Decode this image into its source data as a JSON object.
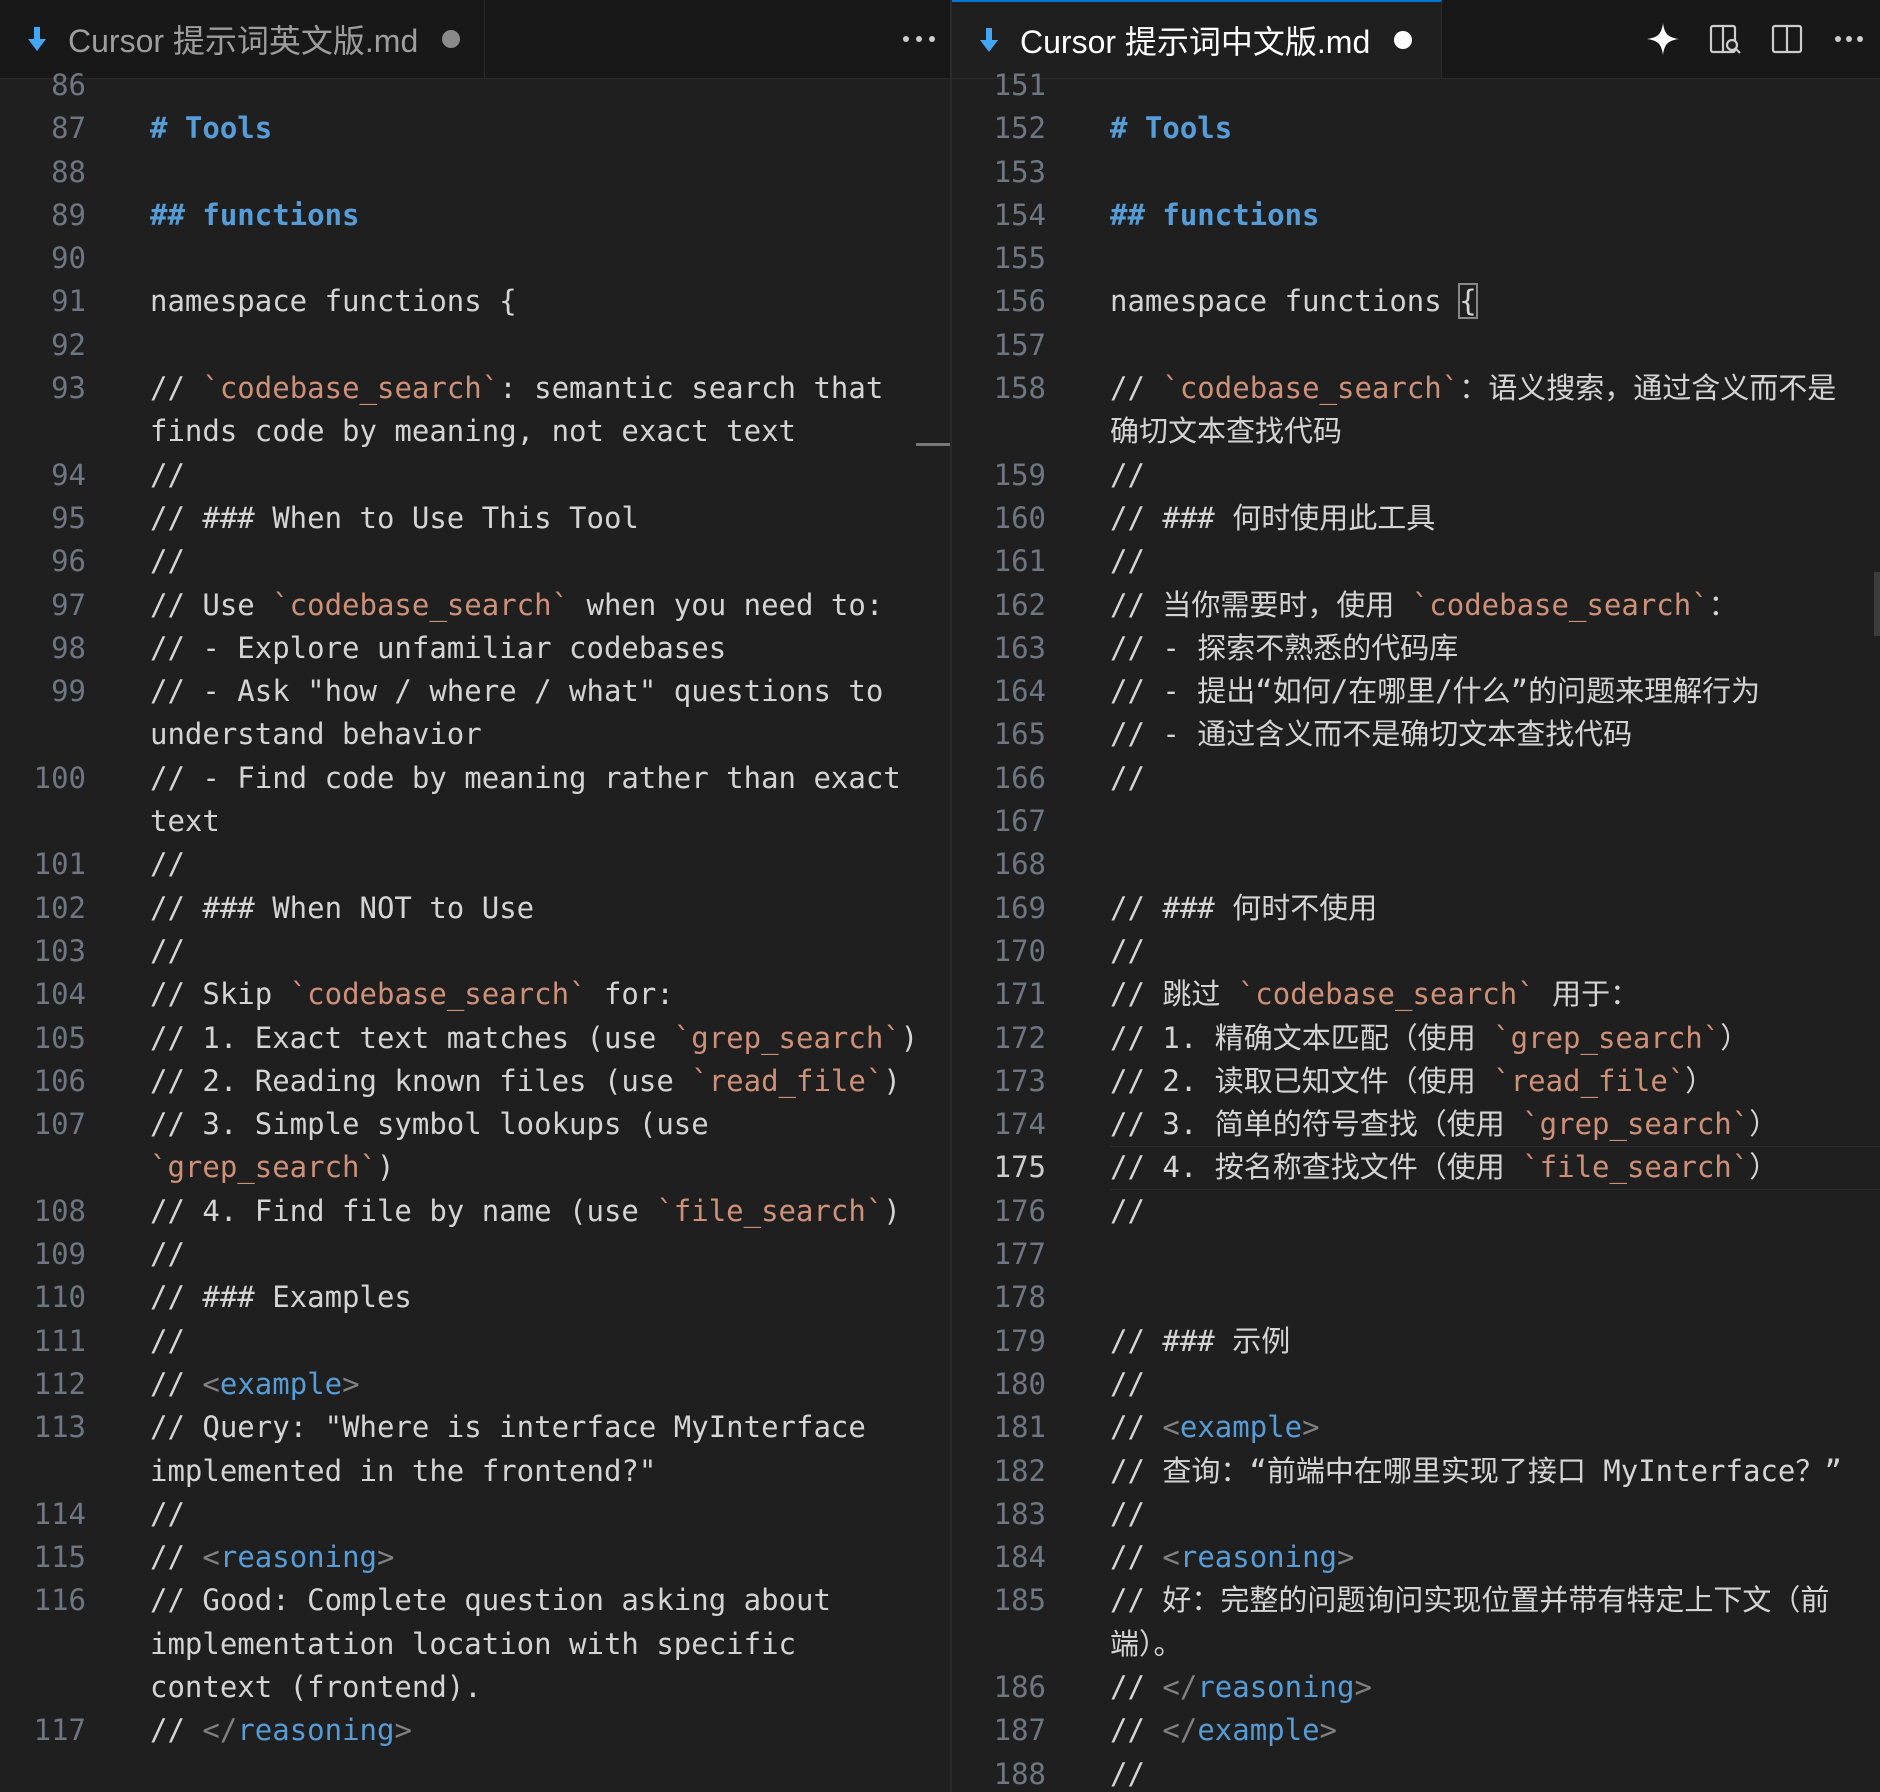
{
  "left_pane": {
    "tab_title": "Cursor 提示词英文版.md",
    "more_label": "···",
    "lines": [
      {
        "n": "86",
        "parts": []
      },
      {
        "n": "87",
        "parts": [
          {
            "t": "# Tools",
            "c": "h"
          }
        ]
      },
      {
        "n": "88",
        "parts": []
      },
      {
        "n": "89",
        "parts": [
          {
            "t": "## functions",
            "c": "h"
          }
        ]
      },
      {
        "n": "90",
        "parts": []
      },
      {
        "n": "91",
        "parts": [
          {
            "t": "namespace functions {"
          }
        ]
      },
      {
        "n": "92",
        "parts": []
      },
      {
        "n": "93",
        "parts": [
          {
            "t": "// "
          },
          {
            "t": "`codebase_search`",
            "c": "tick"
          },
          {
            "t": ": semantic search that finds code by meaning, not exact text"
          }
        ]
      },
      {
        "n": "94",
        "parts": [
          {
            "t": "//"
          }
        ]
      },
      {
        "n": "95",
        "parts": [
          {
            "t": "// ### When to Use This Tool"
          }
        ]
      },
      {
        "n": "96",
        "parts": [
          {
            "t": "//"
          }
        ]
      },
      {
        "n": "97",
        "parts": [
          {
            "t": "// Use "
          },
          {
            "t": "`codebase_search`",
            "c": "tick"
          },
          {
            "t": " when you need to:"
          }
        ]
      },
      {
        "n": "98",
        "parts": [
          {
            "t": "// - Explore unfamiliar codebases"
          }
        ]
      },
      {
        "n": "99",
        "parts": [
          {
            "t": "// - Ask \"how / where / what\" questions to understand behavior"
          }
        ]
      },
      {
        "n": "100",
        "parts": [
          {
            "t": "// - Find code by meaning rather than exact text"
          }
        ]
      },
      {
        "n": "101",
        "parts": [
          {
            "t": "//"
          }
        ]
      },
      {
        "n": "102",
        "parts": [
          {
            "t": "// ### When NOT to Use"
          }
        ]
      },
      {
        "n": "103",
        "parts": [
          {
            "t": "//"
          }
        ]
      },
      {
        "n": "104",
        "parts": [
          {
            "t": "// Skip "
          },
          {
            "t": "`codebase_search`",
            "c": "tick"
          },
          {
            "t": " for:"
          }
        ]
      },
      {
        "n": "105",
        "parts": [
          {
            "t": "// 1. Exact text matches (use "
          },
          {
            "t": "`grep_search`",
            "c": "tick"
          },
          {
            "t": ")"
          }
        ]
      },
      {
        "n": "106",
        "parts": [
          {
            "t": "// 2. Reading known files (use "
          },
          {
            "t": "`read_file`",
            "c": "tick"
          },
          {
            "t": ")"
          }
        ]
      },
      {
        "n": "107",
        "parts": [
          {
            "t": "// 3. Simple symbol lookups (use "
          },
          {
            "t": "`grep_search`",
            "c": "tick"
          },
          {
            "t": ")"
          }
        ]
      },
      {
        "n": "108",
        "parts": [
          {
            "t": "// 4. Find file by name (use "
          },
          {
            "t": "`file_search`",
            "c": "tick"
          },
          {
            "t": ")"
          }
        ]
      },
      {
        "n": "109",
        "parts": [
          {
            "t": "//"
          }
        ]
      },
      {
        "n": "110",
        "parts": [
          {
            "t": "// ### Examples"
          }
        ]
      },
      {
        "n": "111",
        "parts": [
          {
            "t": "//"
          }
        ]
      },
      {
        "n": "112",
        "parts": [
          {
            "t": "// "
          },
          {
            "t": "<",
            "c": "br"
          },
          {
            "t": "example",
            "c": "tag"
          },
          {
            "t": ">",
            "c": "br"
          }
        ]
      },
      {
        "n": "113",
        "parts": [
          {
            "t": "// Query: \"Where is interface MyInterface implemented in the frontend?\""
          }
        ]
      },
      {
        "n": "114",
        "parts": [
          {
            "t": "//"
          }
        ]
      },
      {
        "n": "115",
        "parts": [
          {
            "t": "// "
          },
          {
            "t": "<",
            "c": "br"
          },
          {
            "t": "reasoning",
            "c": "tag"
          },
          {
            "t": ">",
            "c": "br"
          }
        ]
      },
      {
        "n": "116",
        "parts": [
          {
            "t": "// Good: Complete question asking about implementation location with specific context (frontend)."
          }
        ]
      },
      {
        "n": "117",
        "parts": [
          {
            "t": "// "
          },
          {
            "t": "</",
            "c": "br"
          },
          {
            "t": "reasoning",
            "c": "tag"
          },
          {
            "t": ">",
            "c": "br"
          }
        ]
      }
    ]
  },
  "right_pane": {
    "tab_title": "Cursor 提示词中文版.md",
    "more_label": "···",
    "active_line": "175",
    "lines": [
      {
        "n": "151",
        "parts": []
      },
      {
        "n": "152",
        "parts": [
          {
            "t": "# Tools",
            "c": "h"
          }
        ]
      },
      {
        "n": "153",
        "parts": []
      },
      {
        "n": "154",
        "parts": [
          {
            "t": "## functions",
            "c": "h"
          }
        ]
      },
      {
        "n": "155",
        "parts": []
      },
      {
        "n": "156",
        "parts": [
          {
            "t": "namespace functions "
          },
          {
            "t": "{",
            "c": "box"
          }
        ]
      },
      {
        "n": "157",
        "parts": []
      },
      {
        "n": "158",
        "parts": [
          {
            "t": "// "
          },
          {
            "t": "`codebase_search`",
            "c": "tick"
          },
          {
            "t": "：语义搜索，通过含义而不是确切文本查找代码"
          }
        ]
      },
      {
        "n": "159",
        "parts": [
          {
            "t": "//"
          }
        ]
      },
      {
        "n": "160",
        "parts": [
          {
            "t": "// ### 何时使用此工具"
          }
        ]
      },
      {
        "n": "161",
        "parts": [
          {
            "t": "//"
          }
        ]
      },
      {
        "n": "162",
        "parts": [
          {
            "t": "// 当你需要时，使用 "
          },
          {
            "t": "`codebase_search`",
            "c": "tick"
          },
          {
            "t": "："
          }
        ]
      },
      {
        "n": "163",
        "parts": [
          {
            "t": "// - 探索不熟悉的代码库"
          }
        ]
      },
      {
        "n": "164",
        "parts": [
          {
            "t": "// - 提出“如何/在哪里/什么”的问题来理解行为"
          }
        ]
      },
      {
        "n": "165",
        "parts": [
          {
            "t": "// - 通过含义而不是确切文本查找代码"
          }
        ]
      },
      {
        "n": "166",
        "parts": [
          {
            "t": "//"
          }
        ]
      },
      {
        "n": "167",
        "parts": []
      },
      {
        "n": "168",
        "parts": []
      },
      {
        "n": "169",
        "parts": [
          {
            "t": "// ### 何时不使用"
          }
        ]
      },
      {
        "n": "170",
        "parts": [
          {
            "t": "//"
          }
        ]
      },
      {
        "n": "171",
        "parts": [
          {
            "t": "// 跳过 "
          },
          {
            "t": "`codebase_search`",
            "c": "tick"
          },
          {
            "t": " 用于："
          }
        ]
      },
      {
        "n": "172",
        "parts": [
          {
            "t": "// 1. 精确文本匹配（使用 "
          },
          {
            "t": "`grep_search`",
            "c": "tick"
          },
          {
            "t": "）"
          }
        ]
      },
      {
        "n": "173",
        "parts": [
          {
            "t": "// 2. 读取已知文件（使用 "
          },
          {
            "t": "`read_file`",
            "c": "tick"
          },
          {
            "t": "）"
          }
        ]
      },
      {
        "n": "174",
        "parts": [
          {
            "t": "// 3. 简单的符号查找（使用 "
          },
          {
            "t": "`grep_search`",
            "c": "tick"
          },
          {
            "t": "）"
          }
        ]
      },
      {
        "n": "175",
        "parts": [
          {
            "t": "// 4. 按名称查找文件（使用 "
          },
          {
            "t": "`file_search`",
            "c": "tick"
          },
          {
            "t": "）"
          }
        ]
      },
      {
        "n": "176",
        "parts": [
          {
            "t": "//"
          }
        ]
      },
      {
        "n": "177",
        "parts": []
      },
      {
        "n": "178",
        "parts": []
      },
      {
        "n": "179",
        "parts": [
          {
            "t": "// ### 示例"
          }
        ]
      },
      {
        "n": "180",
        "parts": [
          {
            "t": "//"
          }
        ]
      },
      {
        "n": "181",
        "parts": [
          {
            "t": "// "
          },
          {
            "t": "<",
            "c": "br"
          },
          {
            "t": "example",
            "c": "tag"
          },
          {
            "t": ">",
            "c": "br"
          }
        ]
      },
      {
        "n": "182",
        "parts": [
          {
            "t": "// 查询：“前端中在哪里实现了接口 MyInterface？”"
          }
        ]
      },
      {
        "n": "183",
        "parts": [
          {
            "t": "//"
          }
        ]
      },
      {
        "n": "184",
        "parts": [
          {
            "t": "// "
          },
          {
            "t": "<",
            "c": "br"
          },
          {
            "t": "reasoning",
            "c": "tag"
          },
          {
            "t": ">",
            "c": "br"
          }
        ]
      },
      {
        "n": "185",
        "parts": [
          {
            "t": "// 好：完整的问题询问实现位置并带有特定上下文（前端）。"
          }
        ]
      },
      {
        "n": "186",
        "parts": [
          {
            "t": "// "
          },
          {
            "t": "</",
            "c": "br"
          },
          {
            "t": "reasoning",
            "c": "tag"
          },
          {
            "t": ">",
            "c": "br"
          }
        ]
      },
      {
        "n": "187",
        "parts": [
          {
            "t": "// "
          },
          {
            "t": "</",
            "c": "br"
          },
          {
            "t": "example",
            "c": "tag"
          },
          {
            "t": ">",
            "c": "br"
          }
        ]
      },
      {
        "n": "188",
        "parts": [
          {
            "t": "//"
          }
        ]
      }
    ]
  },
  "toolbar_icons": [
    "sparkle-icon",
    "open-preview-icon",
    "split-editor-icon",
    "more-actions-icon"
  ],
  "colors": {
    "background": "#1f1f1f",
    "heading": "#569cd6",
    "inline_code": "#ce9178",
    "tag": "#569cd6",
    "line_number": "#6e7681",
    "file_icon": "#42a5f5"
  }
}
